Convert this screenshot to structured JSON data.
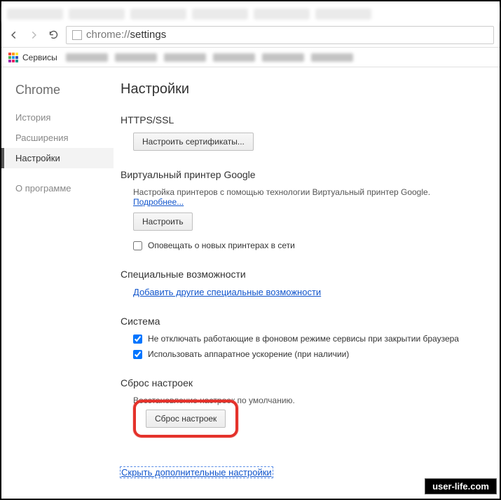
{
  "toolbar": {
    "url_host": "chrome://",
    "url_path": "settings"
  },
  "bookmarks": {
    "apps_label": "Сервисы"
  },
  "sidebar": {
    "brand": "Chrome",
    "items": [
      {
        "label": "История",
        "active": false
      },
      {
        "label": "Расширения",
        "active": false
      },
      {
        "label": "Настройки",
        "active": true
      }
    ],
    "about": "О программе"
  },
  "main": {
    "title": "Настройки",
    "https": {
      "heading": "HTTPS/SSL",
      "cert_button": "Настроить сертификаты..."
    },
    "cloudprint": {
      "heading": "Виртуальный принтер Google",
      "desc": "Настройка принтеров с помощью технологии Виртуальный принтер Google.",
      "more": "Подробнее...",
      "configure_button": "Настроить",
      "notify_label": "Оповещать о новых принтерах в сети"
    },
    "a11y": {
      "heading": "Специальные возможности",
      "link": "Добавить другие специальные возможности"
    },
    "system": {
      "heading": "Система",
      "bg_label": "Не отключать работающие в фоновом режиме сервисы при закрытии браузера",
      "hw_label": "Использовать аппаратное ускорение (при наличии)"
    },
    "reset": {
      "heading": "Сброс настроек",
      "desc": "Восстановление настроек по умолчанию.",
      "button": "Сброс настроек"
    },
    "hide_link": "Скрыть дополнительные настройки"
  },
  "watermark": "user-life.com"
}
